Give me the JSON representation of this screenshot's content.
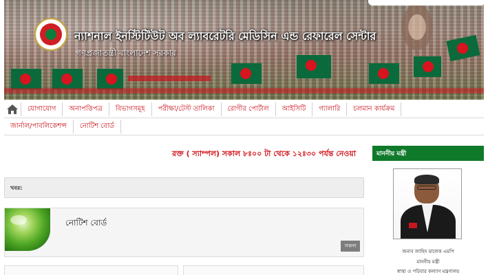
{
  "header": {
    "title": "ন্যাশনাল ইনস্টিটিউট অব ল্যাবরেটরি মেডিসিন এন্ড রেফারেল সেন্টার",
    "subtitle": "গণপ্রজাতন্ত্রী বাংলাদেশ সরকার",
    "seal_icon": "government-seal-icon"
  },
  "nav": {
    "home_icon": "home-icon",
    "row1": [
      "যোগাযোগ",
      "অনাপত্তিপত্র",
      "বিভাগসমূহ",
      "পরীক্ষা/টেস্ট তালিকা",
      "রোগীর পোর্টাল",
      "আইসিটি",
      "গ্যালারি",
      "চলমান কার্যক্রম"
    ],
    "row2": [
      "জার্নাল/পাবলিকেশন্স",
      "নোটিশ বোর্ড"
    ]
  },
  "main": {
    "marquee": "রক্ত ( স্যাম্পল) সকাল ৮ঃ০০ টা থেকে ১২ঃ৩০ পর্যন্ত নেওয়া",
    "news_label": "খবর:",
    "notice": {
      "title": "নোটিশ বোর্ড",
      "all_button": "সকল"
    }
  },
  "sidebar": {
    "minister_heading": "মাননীয় মন্ত্রী",
    "minister_name": "জনাব জাহিদ মালেক এমপি",
    "minister_role": "মাননীয় মন্ত্রী",
    "minister_ministry": "স্বাস্থ্য ও পরিবার কল্যাণ মন্ত্রণালয়"
  },
  "colors": {
    "nav_text": "#c8151d",
    "marquee_text": "#d0141c",
    "minister_header_bg": "#0f7a2a"
  }
}
